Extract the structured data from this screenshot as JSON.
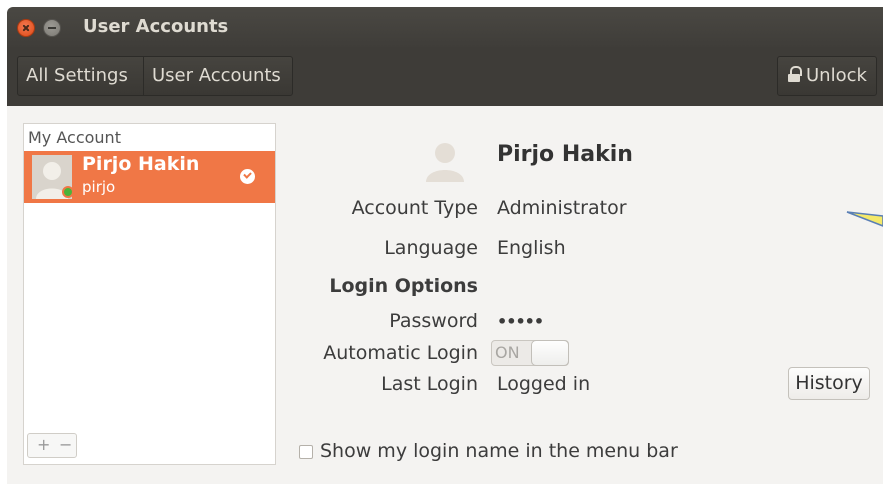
{
  "window": {
    "title": "User Accounts"
  },
  "toolbar": {
    "all_settings": "All Settings",
    "user_accounts": "User Accounts",
    "unlock": "Unlock"
  },
  "sidebar": {
    "header": "My Account",
    "user": {
      "name": "Pirjo Hakin",
      "login": "pirjo",
      "status_color": "#4bb33a"
    }
  },
  "details": {
    "name": "Pirjo Hakin",
    "account_type_label": "Account Type",
    "account_type": "Administrator",
    "language_label": "Language",
    "language": "English",
    "login_options_label": "Login Options",
    "password_label": "Password",
    "password": "•••••",
    "auto_login_label": "Automatic Login",
    "auto_login_state": "ON",
    "last_login_label": "Last Login",
    "last_login": "Logged in",
    "history_button": "History",
    "show_login_name_label": "Show my login name in the menu bar"
  },
  "list_controls": {
    "add": "+",
    "remove": "−"
  },
  "colors": {
    "selection": "#f07746",
    "titlebar": "#3f3d39"
  }
}
